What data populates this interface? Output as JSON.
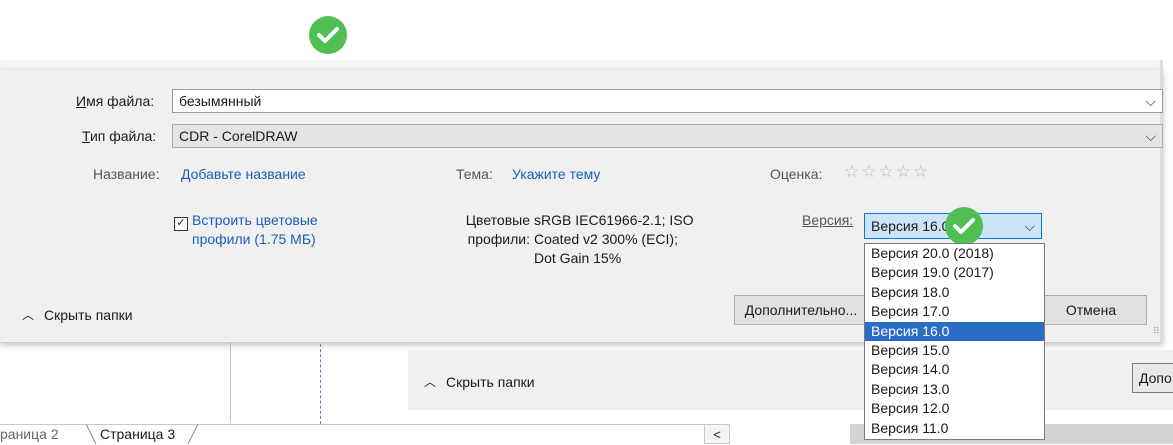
{
  "dialog": {
    "file_name_label": "Имя файла:",
    "file_name_value": "безымянный",
    "file_type_label": "Тип файла:",
    "file_type_value": "CDR - CorelDRAW",
    "title_label": "Название:",
    "title_link": "Добавьте название",
    "theme_label": "Тема:",
    "theme_link": "Укажите тему",
    "rating_label": "Оценка:",
    "rating_stars": "☆☆☆☆☆",
    "embed_line1": "Встроить цветовые",
    "embed_line2": "профили (1.75 МБ)",
    "embed_checked": true,
    "color_profiles_label1": "Цветовые",
    "color_profiles_label2": "профили:",
    "color_profiles_value1": "sRGB IEC61966-2.1; ISO",
    "color_profiles_value2": "Coated v2 300% (ECI);",
    "color_profiles_value3": "Dot Gain 15%",
    "version_label": "Версия:",
    "version_selected": "Версия 16.0",
    "hide_folders": "Скрыть папки",
    "advanced_button": "Дополнительно...",
    "cancel_button": "Отмена"
  },
  "version_options": [
    "Версия 20.0 (2018)",
    "Версия 19.0 (2017)",
    "Версия 18.0",
    "Версия 17.0",
    "Версия 16.0",
    "Версия 15.0",
    "Версия 14.0",
    "Версия 13.0",
    "Версия 12.0",
    "Версия 11.0"
  ],
  "selected_index": 4,
  "lower": {
    "hide_folders": "Скрыть папки",
    "partial_button": "Допо"
  },
  "tabs": [
    {
      "label": "раница 2",
      "active": false
    },
    {
      "label": "Страница 3",
      "active": true
    }
  ],
  "colors": {
    "accent": "#2b6cc4",
    "link": "#1a5eb8",
    "check_badge": "#4fbf54",
    "combo_bg": "#cce4f7"
  }
}
